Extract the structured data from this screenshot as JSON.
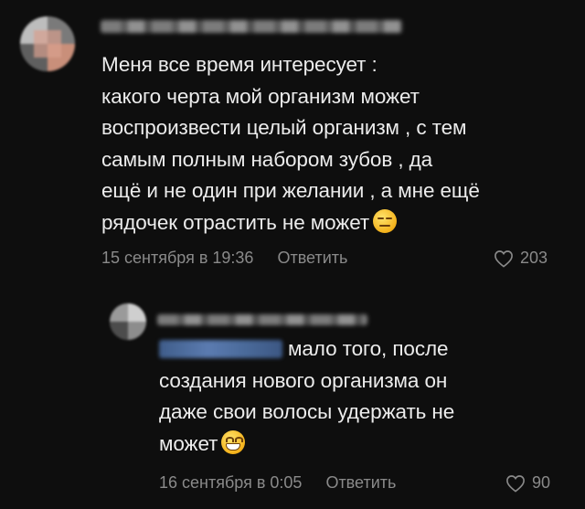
{
  "comments": [
    {
      "text": "Меня все время интересует :\nкакого черта мой организм может\nвоспроизвести целый организм , с тем\nсамым полным набором зубов , да\nещё и не один при желании , а мне ещё\nрядочек отрастить не может",
      "emoji": "expressionless-face-emoji",
      "timestamp": "15 сентября в 19:36",
      "reply_label": "Ответить",
      "likes": "203"
    },
    {
      "text": "мало того, после\nсоздания нового организма он\nдаже свои волосы удержать не\nможет",
      "emoji": "grinning-face-emoji",
      "timestamp": "16 сентября в 0:05",
      "reply_label": "Ответить",
      "likes": "90"
    }
  ],
  "colors": {
    "background": "#0e0e0e",
    "text": "#ececec",
    "meta": "#8a8a8a",
    "mention": "#5b7bb0"
  }
}
